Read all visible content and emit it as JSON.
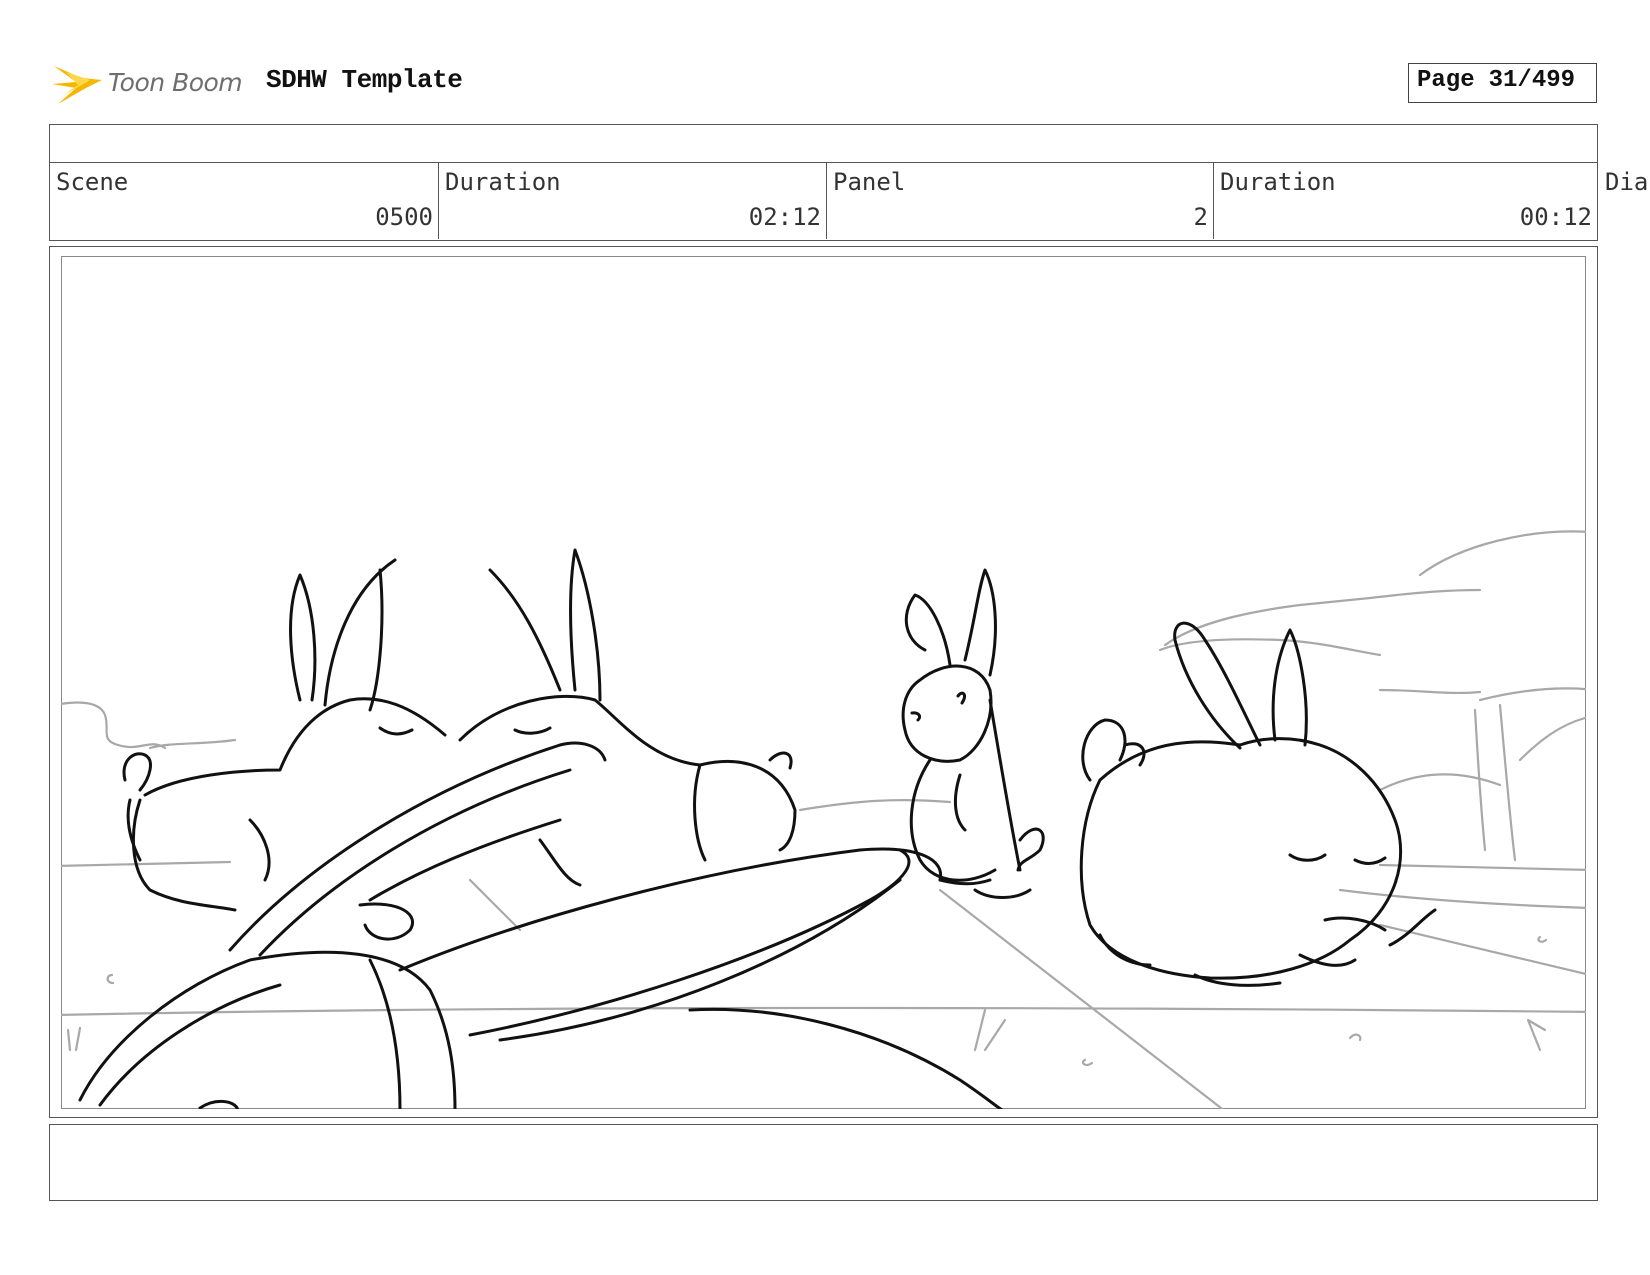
{
  "header": {
    "logo_text": "Toon Boom",
    "title": "SDHW Template",
    "page_label": "Page",
    "page_number": "31/499"
  },
  "info": {
    "scene_label": "Scene",
    "scene_value": "0500",
    "scene_duration_label": "Duration",
    "scene_duration_value": "02:12",
    "panel_label": "Panel",
    "panel_value": "2",
    "panel_duration_label": "Duration",
    "panel_duration_value": "00:12",
    "dialogue_label": "Dia"
  },
  "colors": {
    "logo_accent": "#f5b800",
    "sketch_line": "#111111",
    "background_line": "#a8a8a8"
  },
  "panel": {
    "image_description_icon": "storyboard-sketch"
  }
}
